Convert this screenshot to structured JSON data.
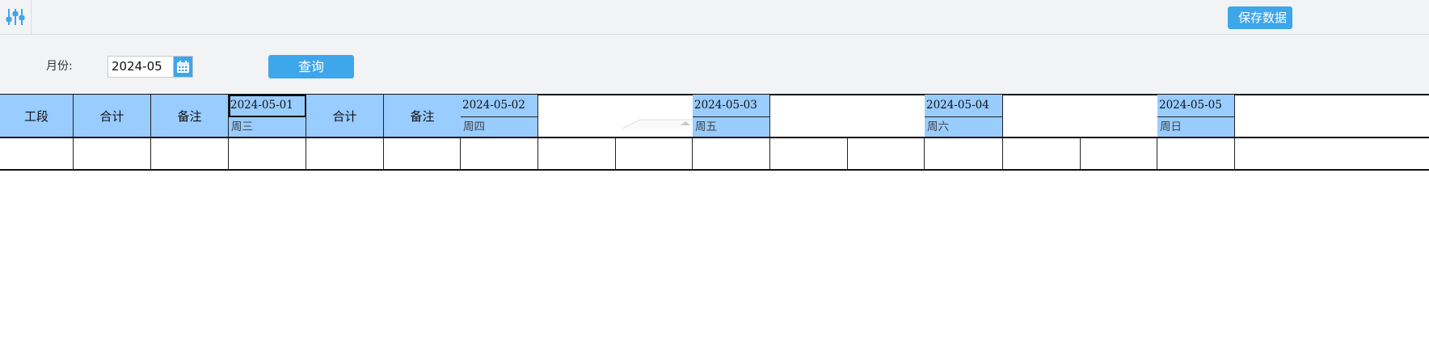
{
  "toolbar": {
    "settings_icon": "sliders-icon",
    "save_label": "保存数据"
  },
  "filter": {
    "month_label": "月份:",
    "month_value": "2024-05",
    "calendar_icon": "calendar-icon",
    "query_label": "查询"
  },
  "table": {
    "fixed_headers": [
      "工段",
      "合计",
      "备注"
    ],
    "days": [
      {
        "date": "2024-05-01",
        "weekday": "周三",
        "subheaders": [
          "合计",
          "备注"
        ]
      },
      {
        "date": "2024-05-02",
        "weekday": "周四",
        "subheaders": [
          "",
          ""
        ]
      },
      {
        "date": "2024-05-03",
        "weekday": "周五",
        "subheaders": [
          "",
          ""
        ]
      },
      {
        "date": "2024-05-04",
        "weekday": "周六",
        "subheaders": [
          "",
          ""
        ]
      },
      {
        "date": "2024-05-05",
        "weekday": "周日",
        "subheaders": [
          "",
          ""
        ]
      }
    ]
  },
  "colors": {
    "header_bg": "#99ccff",
    "accent": "#3ea6ea",
    "toolbar_bg": "#f2f3f5"
  }
}
